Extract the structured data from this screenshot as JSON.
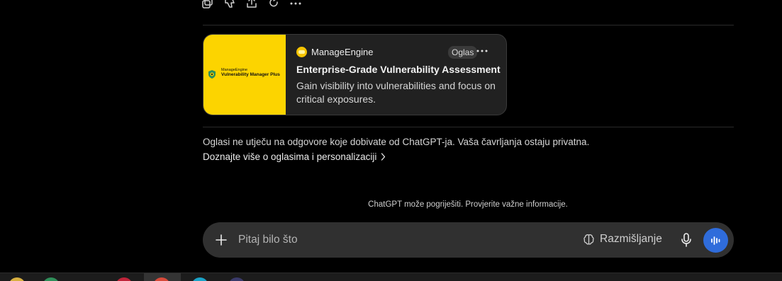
{
  "message_actions": [
    {
      "name": "copy-icon",
      "label": "Copy"
    },
    {
      "name": "thumbs-down-icon",
      "label": "Bad response"
    },
    {
      "name": "share-icon",
      "label": "Share"
    },
    {
      "name": "regenerate-icon",
      "label": "Regenerate"
    },
    {
      "name": "more-icon",
      "label": "More"
    }
  ],
  "ad": {
    "image_brand": "ManageEngine",
    "image_product": "Vulnerability Manager Plus",
    "advertiser": "ManageEngine",
    "badge": "Oglas",
    "headline": "Enterprise-Grade Vulnerability Assessment",
    "description": "Gain visibility into vulnerabilities and focus on critical exposures.",
    "image_bg_color": "#fcd400"
  },
  "disclaimer": {
    "text": "Oglasi ne utječu na odgovore koje dobivate od ChatGPT-ja. Vaša čavrljanja ostaju privatna.",
    "link_text": "Doznajte više o oglasima i personalizaciji"
  },
  "footer_note": "ChatGPT može pogriješiti. Provjerite važne informacije.",
  "composer": {
    "placeholder": "Pitaj bilo što",
    "think_label": "Razmišljanje",
    "accent_color": "#2f6cdb"
  },
  "taskbar": {
    "icons": [
      "app-icon-1",
      "app-icon-2",
      "app-icon-3",
      "app-icon-4",
      "app-icon-5",
      "app-icon-6"
    ]
  }
}
